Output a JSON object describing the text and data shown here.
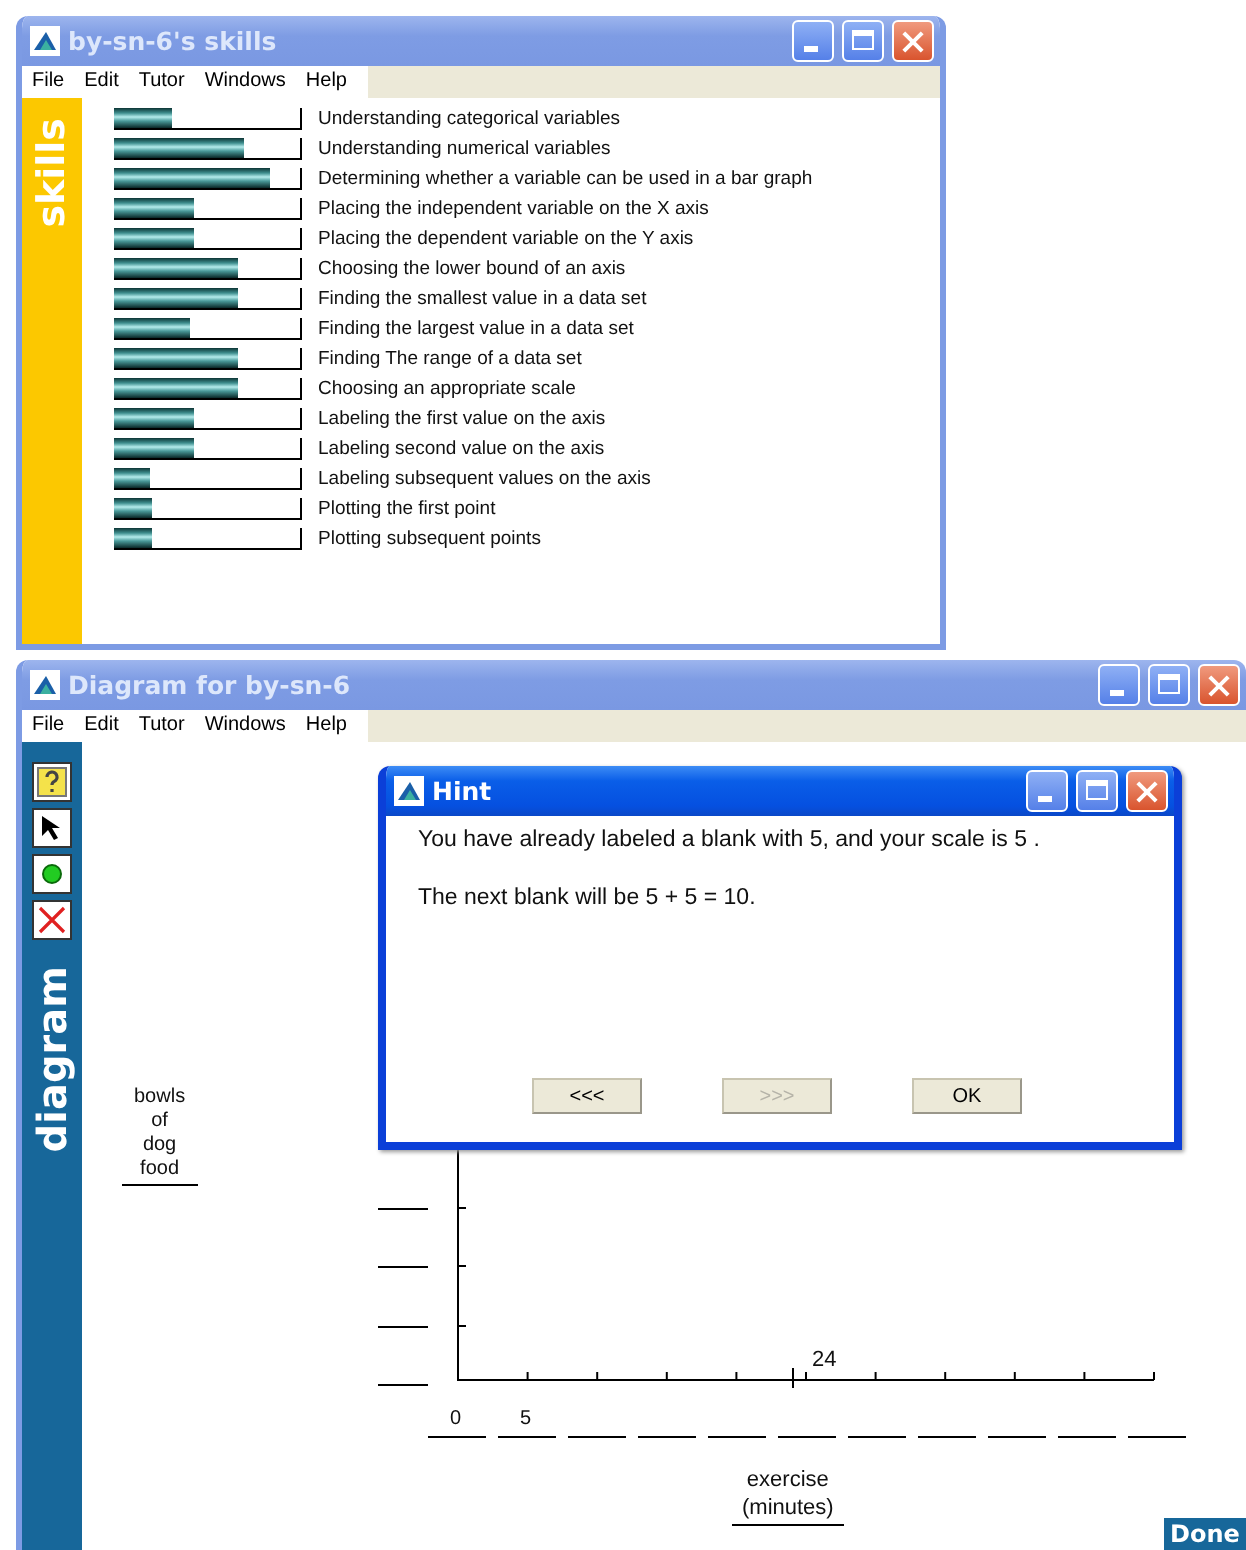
{
  "skills_window": {
    "title": "by-sn-6's skills",
    "menu": [
      "File",
      "Edit",
      "Tutor",
      "Windows",
      "Help"
    ],
    "sidebar_label": "skills",
    "skills": [
      {
        "name": "Understanding categorical variables",
        "level": 0.31
      },
      {
        "name": "Understanding numerical variables",
        "level": 0.7
      },
      {
        "name": "Determining whether a variable can be used in a bar graph",
        "level": 0.84
      },
      {
        "name": "Placing the independent variable on the X axis",
        "level": 0.43
      },
      {
        "name": "Placing the dependent variable on the Y axis",
        "level": 0.43
      },
      {
        "name": "Choosing the lower bound of an axis",
        "level": 0.67
      },
      {
        "name": "Finding the smallest value in a data set",
        "level": 0.67
      },
      {
        "name": "Finding the largest value in a data set",
        "level": 0.41
      },
      {
        "name": "Finding The range of a data set",
        "level": 0.67
      },
      {
        "name": "Choosing an appropriate scale",
        "level": 0.67
      },
      {
        "name": "Labeling the first value on the axis",
        "level": 0.43
      },
      {
        "name": "Labeling second value on the axis",
        "level": 0.43
      },
      {
        "name": "Labeling subsequent values on the axis",
        "level": 0.19
      },
      {
        "name": "Plotting the first point",
        "level": 0.2
      },
      {
        "name": "Plotting subsequent points",
        "level": 0.2
      }
    ]
  },
  "diagram_window": {
    "title": "Diagram for by-sn-6",
    "menu": [
      "File",
      "Edit",
      "Tutor",
      "Windows",
      "Help"
    ],
    "tools": [
      {
        "kind": "help"
      },
      {
        "kind": "pointer"
      },
      {
        "kind": "point"
      },
      {
        "kind": "delete"
      }
    ],
    "sidebar_label": "diagram",
    "y_axis_label": "bowls of dog food",
    "x_axis_label": "exercise (minutes)",
    "x_axis_values": [
      "0",
      "5"
    ],
    "point_label": "24",
    "done_button": "Done"
  },
  "hint": {
    "title": "Hint",
    "messages": [
      "You have already labeled a blank with 5, and your scale is 5 .",
      "The next blank will be 5 + 5 = 10."
    ],
    "buttons": [
      {
        "label": "<<<",
        "disabled": false
      },
      {
        "label": ">>>",
        "disabled": true
      },
      {
        "label": "OK",
        "disabled": false
      }
    ]
  }
}
